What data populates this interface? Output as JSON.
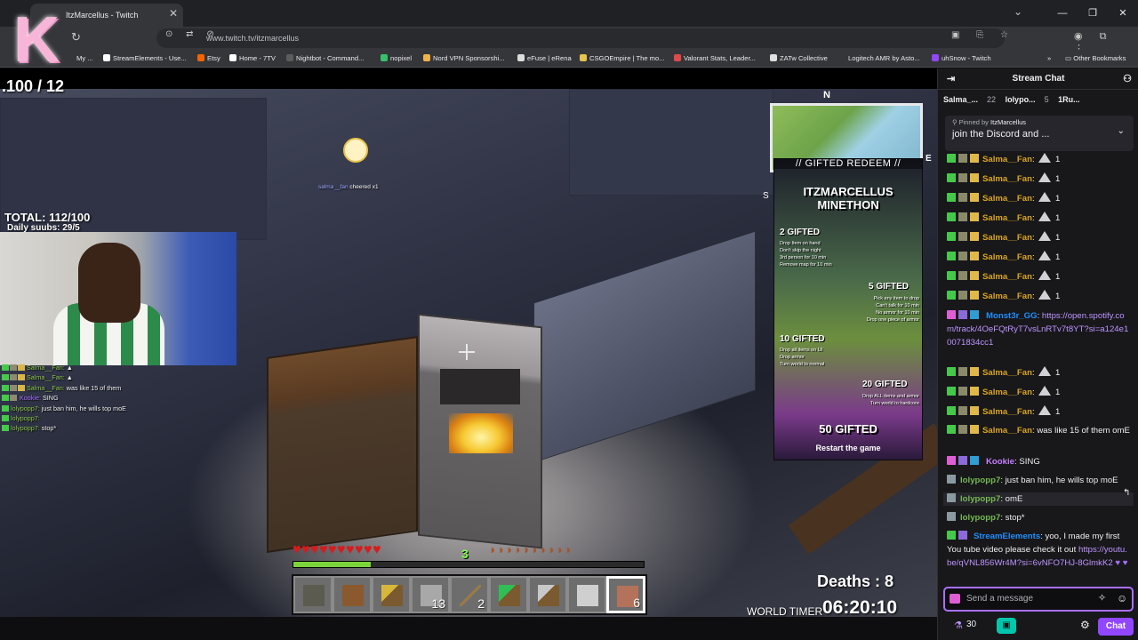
{
  "browser": {
    "tab_title": "ItzMarcellus - Twitch",
    "url": "www.twitch.tv/itzmarcellus",
    "bookmarks": [
      "My ...",
      "StreamElements - Use...",
      "Etsy",
      "Home - 7TV",
      "Nightbot - Command...",
      "nopixel",
      "Nord VPN Sponsorshi...",
      "eFuse | eRena",
      "CSGOEmpire | The mo...",
      "Valorant Stats, Leader...",
      "ZATw Collective",
      "Logitech AMR by Asto...",
      "uhSnow - Twitch"
    ],
    "other_bookmarks": "Other Bookmarks"
  },
  "stream": {
    "sub_goal": ".100 / 12",
    "total": "TOTAL: 112/100",
    "daily": "Daily suubs: 29/5",
    "cheer_user": "salma__fan",
    "cheer_text": "cheered x1",
    "overlay_chat": [
      {
        "name": "Salma__Fan:",
        "text": "▲",
        "color": "g"
      },
      {
        "name": "Salma__Fan:",
        "text": "▲",
        "color": "g"
      },
      {
        "name": "Salma__Fan:",
        "text": "was like 15 of them",
        "color": "g"
      },
      {
        "name": "Kookie:",
        "text": "SING",
        "color": "p"
      },
      {
        "name": "lolypopp7:",
        "text": "just ban him, he wills top moE",
        "color": "g"
      },
      {
        "name": "lolypopp7:",
        "text": "",
        "color": "g"
      },
      {
        "name": "lolypopp7:",
        "text": "stop*",
        "color": "g"
      }
    ],
    "minimap": {
      "north": "N",
      "east": "E",
      "south": "S"
    },
    "redeem": {
      "title": "// GIFTED REDEEM //",
      "heading1": "ITZMARCELLUS",
      "heading2": "MINETHON",
      "tier2": "2 GIFTED",
      "tier2_desc": "Drop Item on hand\nDon't skip the night\n3rd person for 10 min\nRemove map for 10 min",
      "tier5": "5 GIFTED",
      "tier5_desc": "Pick any item to drop\nCan't talk for 10 min\nNo armor for 10 min\nDrop one piece of armor",
      "tier10": "10 GIFTED",
      "tier10_desc": "Drop all items on UI\nDrop armor\nTurn world to normal",
      "tier20": "20 GIFTED",
      "tier20_desc": "Drop ALL items and armor\nTurn world to hardcore",
      "tier50": "50 GIFTED",
      "tier50_desc": "Restart the game"
    },
    "hud": {
      "xp_level": "3",
      "xp_progress": 0.22,
      "hotbar_counts": [
        "",
        "",
        "",
        "13",
        "2",
        "",
        "",
        "",
        "6"
      ]
    },
    "deaths": "Deaths : 8",
    "world_timer_label": "WORLD TIMER",
    "world_timer": "06:20:10"
  },
  "chat": {
    "header": "Stream Chat",
    "leaderboard": [
      {
        "name": "Salma_...",
        "value": "22"
      },
      {
        "name": "lolypo...",
        "value": "5"
      },
      {
        "name": "1Ru...",
        "value": ""
      }
    ],
    "pinned_by_label": "Pinned by",
    "pinned_by": "ItzMarcellus",
    "pinned_message": "join the Discord and ...",
    "messages": [
      {
        "user": "Salma__Fan",
        "text": "1",
        "type": "salma"
      },
      {
        "user": "Salma__Fan",
        "text": "1",
        "type": "salma"
      },
      {
        "user": "Salma__Fan",
        "text": "1",
        "type": "salma"
      },
      {
        "user": "Salma__Fan",
        "text": "1",
        "type": "salma"
      },
      {
        "user": "Salma__Fan",
        "text": "1",
        "type": "salma"
      },
      {
        "user": "Salma__Fan",
        "text": "1",
        "type": "salma"
      },
      {
        "user": "Salma__Fan",
        "text": "1",
        "type": "salma"
      },
      {
        "user": "Salma__Fan",
        "text": "1",
        "type": "salma"
      },
      {
        "user": "Monst3r_GG",
        "text": "https://open.spotify.com/track/4OeFQtRyT7vsLnRTv7t8YT?si=a124e10071834cc1",
        "type": "monster"
      },
      {
        "user": "Salma__Fan",
        "text": "1",
        "type": "salma"
      },
      {
        "user": "Salma__Fan",
        "text": "1",
        "type": "salma"
      },
      {
        "user": "Salma__Fan",
        "text": "1",
        "type": "salma"
      },
      {
        "user": "Salma__Fan",
        "text": "was like 15 of them omE",
        "type": "salma-text"
      },
      {
        "user": "Kookie",
        "text": "SING",
        "type": "kookie"
      },
      {
        "user": "lolypopp7",
        "text": "just ban him, he wills top moE",
        "type": "loly"
      },
      {
        "user": "lolypopp7",
        "text": "omE",
        "type": "loly"
      },
      {
        "user": "lolypopp7",
        "text": "stop*",
        "type": "loly"
      },
      {
        "user": "StreamElements",
        "text": "yoo, I made my first You tube video please check it out",
        "link": "https://youtu.be/qVNL856Wr4M?si=6vNFO7HJ-8GlmkK2",
        "type": "se"
      }
    ],
    "input_placeholder": "Send a message",
    "points": "30",
    "chat_button": "Chat"
  }
}
